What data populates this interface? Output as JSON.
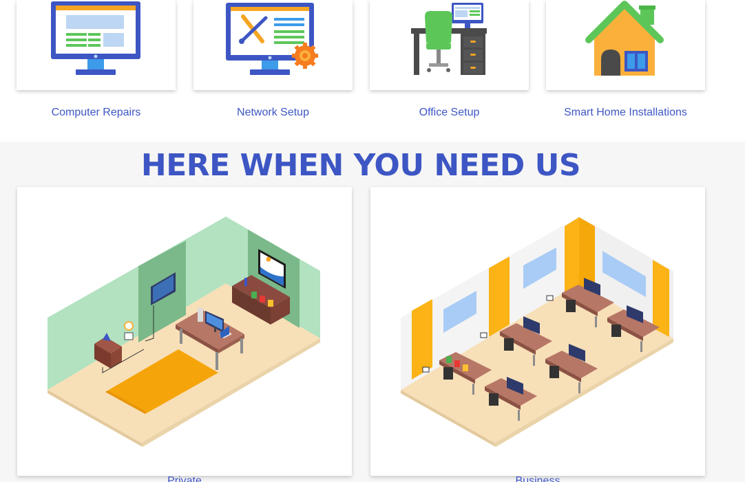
{
  "services": [
    {
      "label": "Computer Repairs",
      "icon": "computer-monitor-icon"
    },
    {
      "label": "Network Setup",
      "icon": "monitor-tools-gear-icon"
    },
    {
      "label": "Office Setup",
      "icon": "office-desk-chair-icon"
    },
    {
      "label": "Smart Home Installations",
      "icon": "smart-house-icon"
    }
  ],
  "section": {
    "title": "HERE WHEN YOU NEED US",
    "cards": [
      {
        "label": "Private",
        "illustration": "home-room-illustration"
      },
      {
        "label": "Business",
        "illustration": "office-room-illustration"
      }
    ]
  },
  "colors": {
    "brand_blue": "#3d56c4",
    "section_bg": "#f6f6f6"
  }
}
